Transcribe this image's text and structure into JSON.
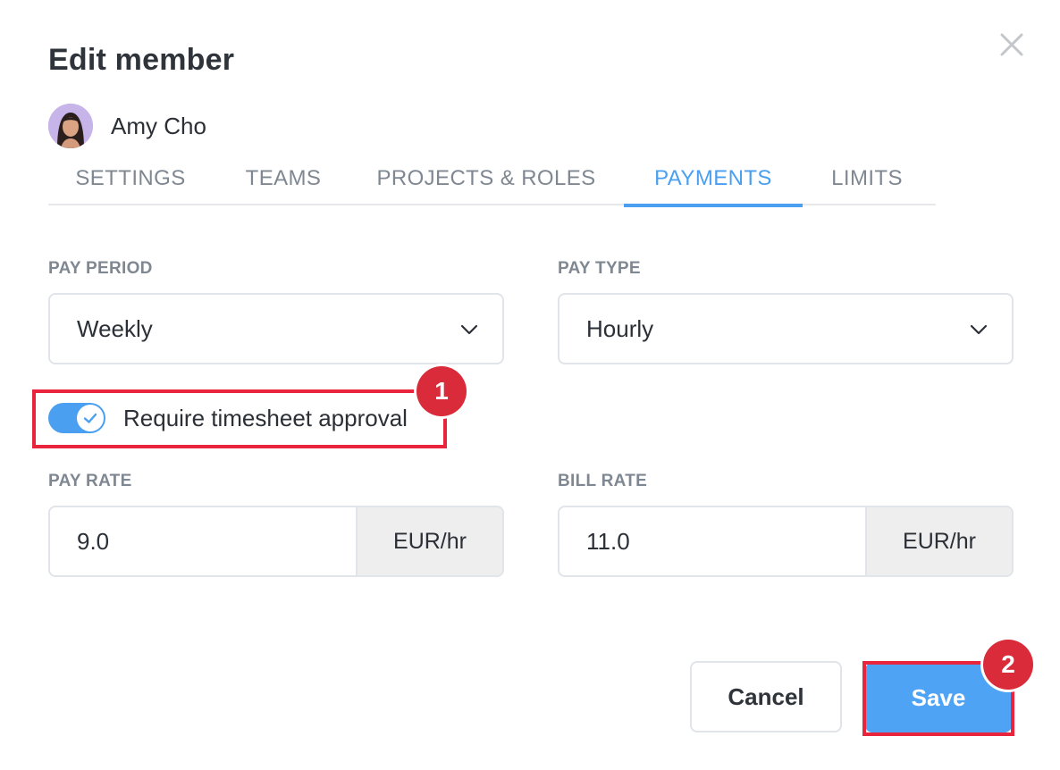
{
  "dialog": {
    "title": "Edit member"
  },
  "member": {
    "name": "Amy Cho"
  },
  "tabs": [
    {
      "label": "SETTINGS",
      "active": false
    },
    {
      "label": "TEAMS",
      "active": false
    },
    {
      "label": "PROJECTS & ROLES",
      "active": false
    },
    {
      "label": "PAYMENTS",
      "active": true
    },
    {
      "label": "LIMITS",
      "active": false
    }
  ],
  "payments": {
    "pay_period": {
      "label": "PAY PERIOD",
      "value": "Weekly"
    },
    "pay_type": {
      "label": "PAY TYPE",
      "value": "Hourly"
    },
    "timesheet_approval": {
      "label": "Require timesheet approval",
      "enabled": true
    },
    "pay_rate": {
      "label": "PAY RATE",
      "value": "9.0",
      "unit": "EUR/hr"
    },
    "bill_rate": {
      "label": "BILL RATE",
      "value": "11.0",
      "unit": "EUR/hr"
    }
  },
  "actions": {
    "cancel_label": "Cancel",
    "save_label": "Save"
  },
  "annotations": {
    "step1": "1",
    "step2": "2"
  },
  "colors": {
    "accent": "#4a9ff0",
    "save_button": "#4fa3f5",
    "highlight": "#e8253c",
    "badge": "#d92b3a"
  },
  "icons": {
    "close": "close-icon",
    "dropdown": "chevron-down-icon",
    "toggle_check": "check-icon"
  }
}
